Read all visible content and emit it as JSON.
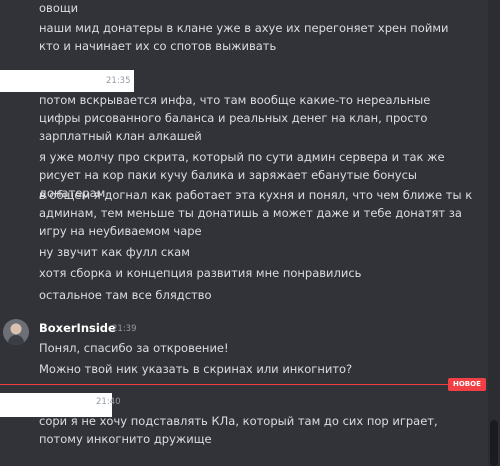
{
  "messages_top": [
    "овощи",
    "наши мид донатеры в клане уже в ахуе их перегоняет хрен пойми кто и начинает их со спотов выживать"
  ],
  "msg_group1": {
    "time": "21:35",
    "lines": [
      "потом вскрывается инфа, что там вообще какие-то нереальные цифры рисованного баланса и реальных денег на клан, просто зарплатный клан алкашей",
      "я уже молчу про скрита, который по сути админ сервера и так же рисует на кор паки кучу балика и заряжает ебанутые бонусы донатерам",
      "в общем я догнал как работает эта кухня и понял, что чем ближе ты к админам, тем меньше ты донатишь а может даже и тебе донатят за игру на неубиваемом чаре",
      "ну звучит как фулл скам",
      "хотя сборка и концепция развития мне понравились",
      "остальное там все блядство"
    ]
  },
  "msg_group2": {
    "username": "BoxerInside",
    "time": "21:39",
    "lines": [
      "Понял, спасибо за откровение!",
      "Можно твой ник указать в скринах или инкогнито?"
    ]
  },
  "new_divider": {
    "label": "НОВОЕ"
  },
  "msg_group3": {
    "time": "21:40",
    "lines": [
      "сори я не хочу подставлять КЛа, который там до сих пор играет, потому инкогнито дружище"
    ]
  }
}
